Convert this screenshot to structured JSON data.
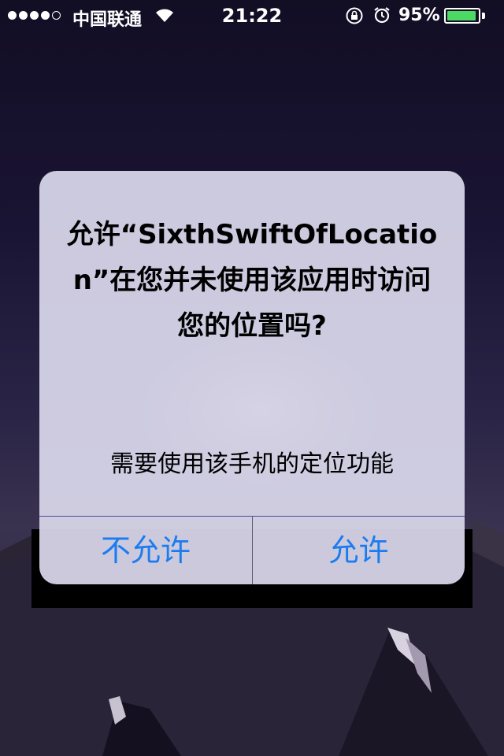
{
  "status_bar": {
    "carrier": "中国联通",
    "time": "21:22",
    "battery_percent": "95%",
    "battery_level": 0.95,
    "battery_color": "#4cd964",
    "signal_bars_filled": 4,
    "signal_bars_total": 5,
    "icons": [
      "signal-icon",
      "wifi-icon",
      "rotation-lock-icon",
      "alarm-icon",
      "battery-icon"
    ]
  },
  "alert": {
    "title": "允许“SixthSwiftOfLocation”在您并未使用该应用时访问您的位置吗?",
    "message": "需要使用该手机的定位功能",
    "buttons": {
      "deny_label": "不允许",
      "allow_label": "允许"
    },
    "button_color": "#1a7cf0"
  }
}
